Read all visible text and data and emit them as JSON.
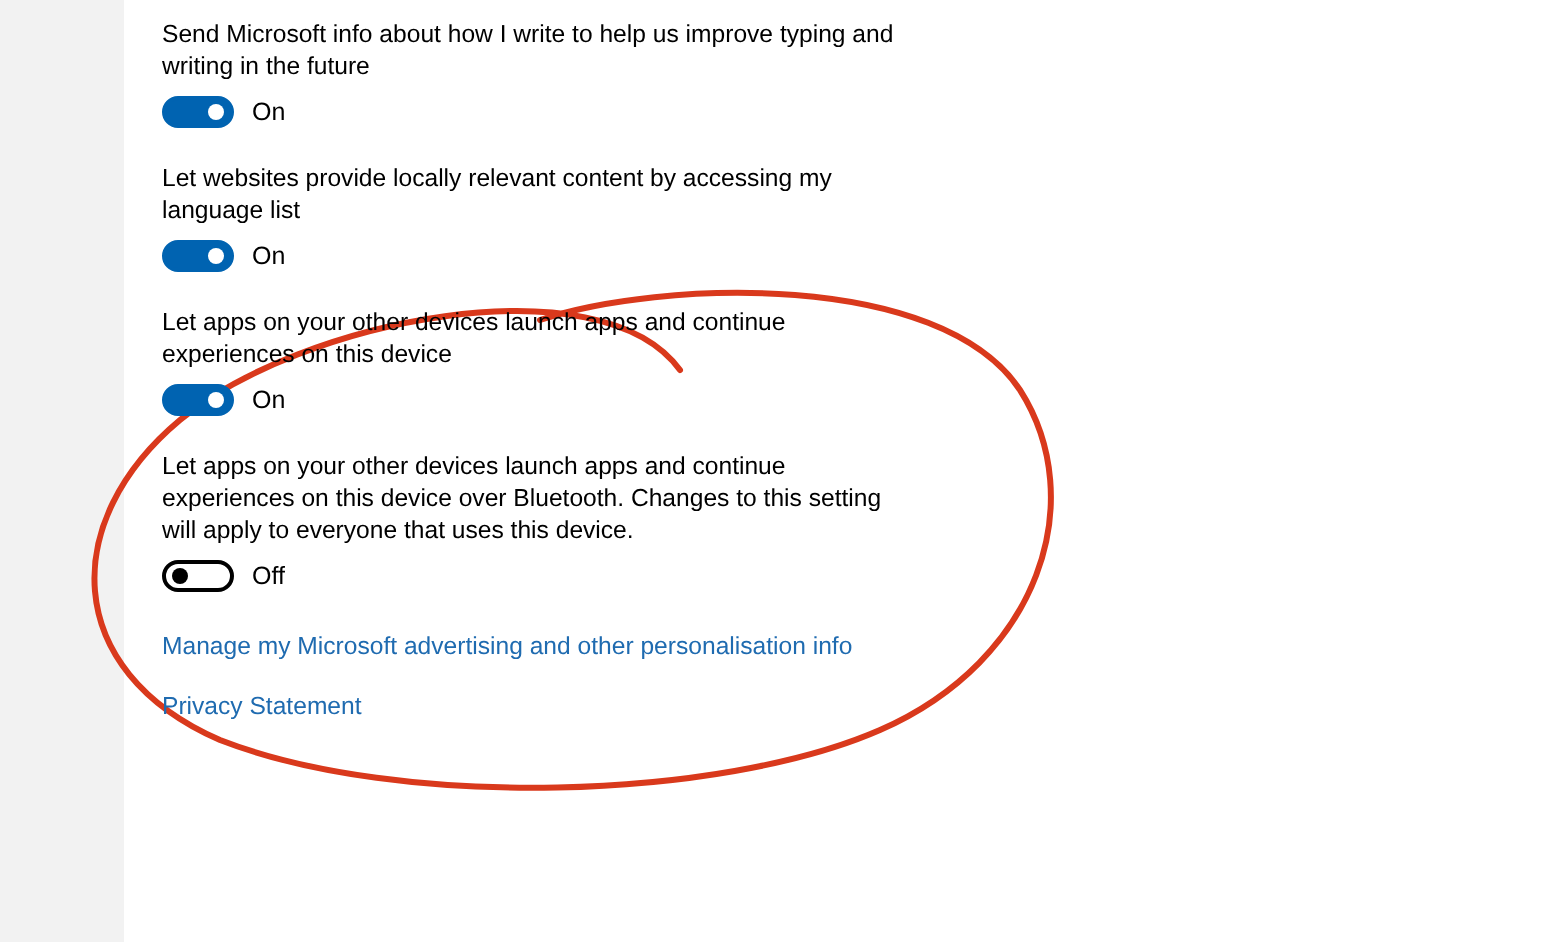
{
  "settings": [
    {
      "description": "Send Microsoft info about how I write to help us improve typing and writing in the future",
      "on": true,
      "state_label": "On"
    },
    {
      "description": "Let websites provide locally relevant content by accessing my language list",
      "on": true,
      "state_label": "On"
    },
    {
      "description": "Let apps on your other devices launch apps and continue experiences on this device",
      "on": true,
      "state_label": "On"
    },
    {
      "description": "Let apps on your other devices launch apps and continue experiences on this device over Bluetooth. Changes to this setting will apply to everyone that uses this device.",
      "on": false,
      "state_label": "Off"
    }
  ],
  "links": [
    "Manage my Microsoft advertising and other personalisation info",
    "Privacy Statement"
  ]
}
